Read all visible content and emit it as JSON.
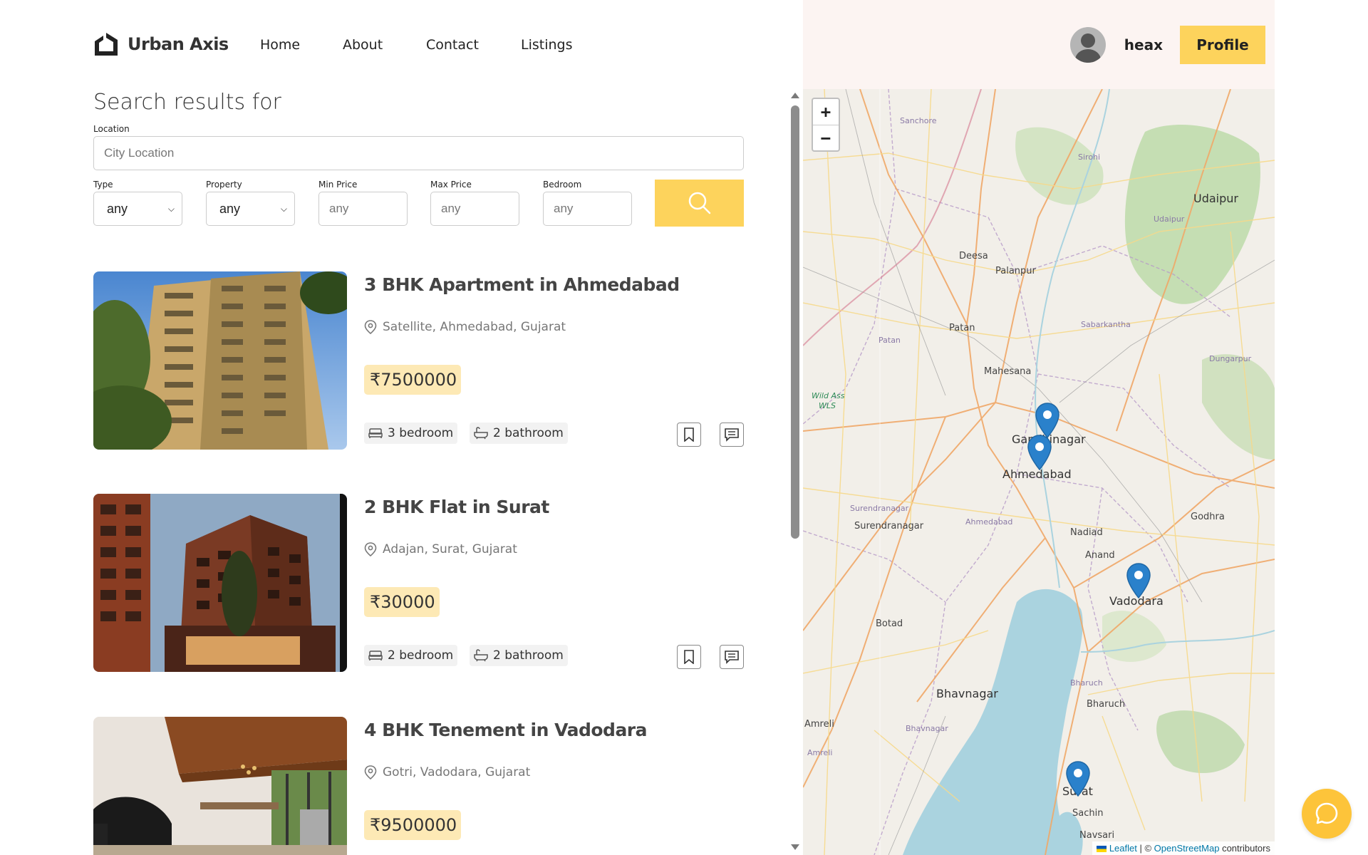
{
  "brand": {
    "name": "Urban Axis"
  },
  "nav": {
    "items": [
      "Home",
      "About",
      "Contact",
      "Listings"
    ]
  },
  "user": {
    "name": "heax",
    "profile_label": "Profile"
  },
  "search": {
    "title": "Search results for",
    "location_label": "Location",
    "location_placeholder": "City Location",
    "type_label": "Type",
    "type_value": "any",
    "property_label": "Property",
    "property_value": "any",
    "min_price_label": "Min Price",
    "min_price_placeholder": "any",
    "max_price_label": "Max Price",
    "max_price_placeholder": "any",
    "bedroom_label": "Bedroom",
    "bedroom_placeholder": "any",
    "button_icon": "search-icon"
  },
  "listings": [
    {
      "title": "3 BHK Apartment in Ahmedabad",
      "address": "Satellite, Ahmedabad, Gujarat",
      "price": "₹7500000",
      "bedrooms": "3 bedroom",
      "bathrooms": "2 bathroom"
    },
    {
      "title": "2 BHK Flat in Surat",
      "address": "Adajan, Surat, Gujarat",
      "price": "₹30000",
      "bedrooms": "2 bedroom",
      "bathrooms": "2 bathroom"
    },
    {
      "title": "4 BHK Tenement in Vadodara",
      "address": "Gotri, Vadodara, Gujarat",
      "price": "₹9500000"
    }
  ],
  "map": {
    "zoom_in": "+",
    "zoom_out": "−",
    "cities": {
      "sanchore": "Sanchore",
      "sirohi": "Sirohi",
      "udaipur": "Udaipur",
      "udaipur_small": "Udaipur",
      "deesa": "Deesa",
      "palanpur": "Palanpur",
      "patan": "Patan",
      "patan_small": "Patan",
      "sabarkantha": "Sabarkantha",
      "dungarpur": "Dungarpur",
      "mahesana": "Mahesana",
      "wild_ass": "Wild Ass",
      "wls": "WLS",
      "gandhinagar": "Gandhinagar",
      "ahmedabad": "Ahmedabad",
      "ahmedabad_small": "Ahmedabad",
      "surendranagar": "Surendranagar",
      "surendranagar_small": "Surendranagar",
      "godhra": "Godhra",
      "nadiad": "Nadiad",
      "anand": "Anand",
      "vadodara": "Vadodara",
      "botad": "Botad",
      "bhavnagar": "Bhavnagar",
      "bhavnagar_small": "Bhavnagar",
      "bharuch": "Bharuch",
      "bharuch_small": "Bharuch",
      "amreli": "Amreli",
      "amreli_small": "Amreli",
      "surat": "Surat",
      "sachin": "Sachin",
      "navsari": "Navsari"
    },
    "attribution_leaflet": "Leaflet",
    "attribution_sep": " | © ",
    "attribution_osm": "OpenStreetMap",
    "attribution_tail": " contributors"
  },
  "colors": {
    "accent": "#fdd35c",
    "price_bg": "#fde9b5",
    "panel_bg": "#fcf4f2",
    "marker": "#2a81cb"
  }
}
